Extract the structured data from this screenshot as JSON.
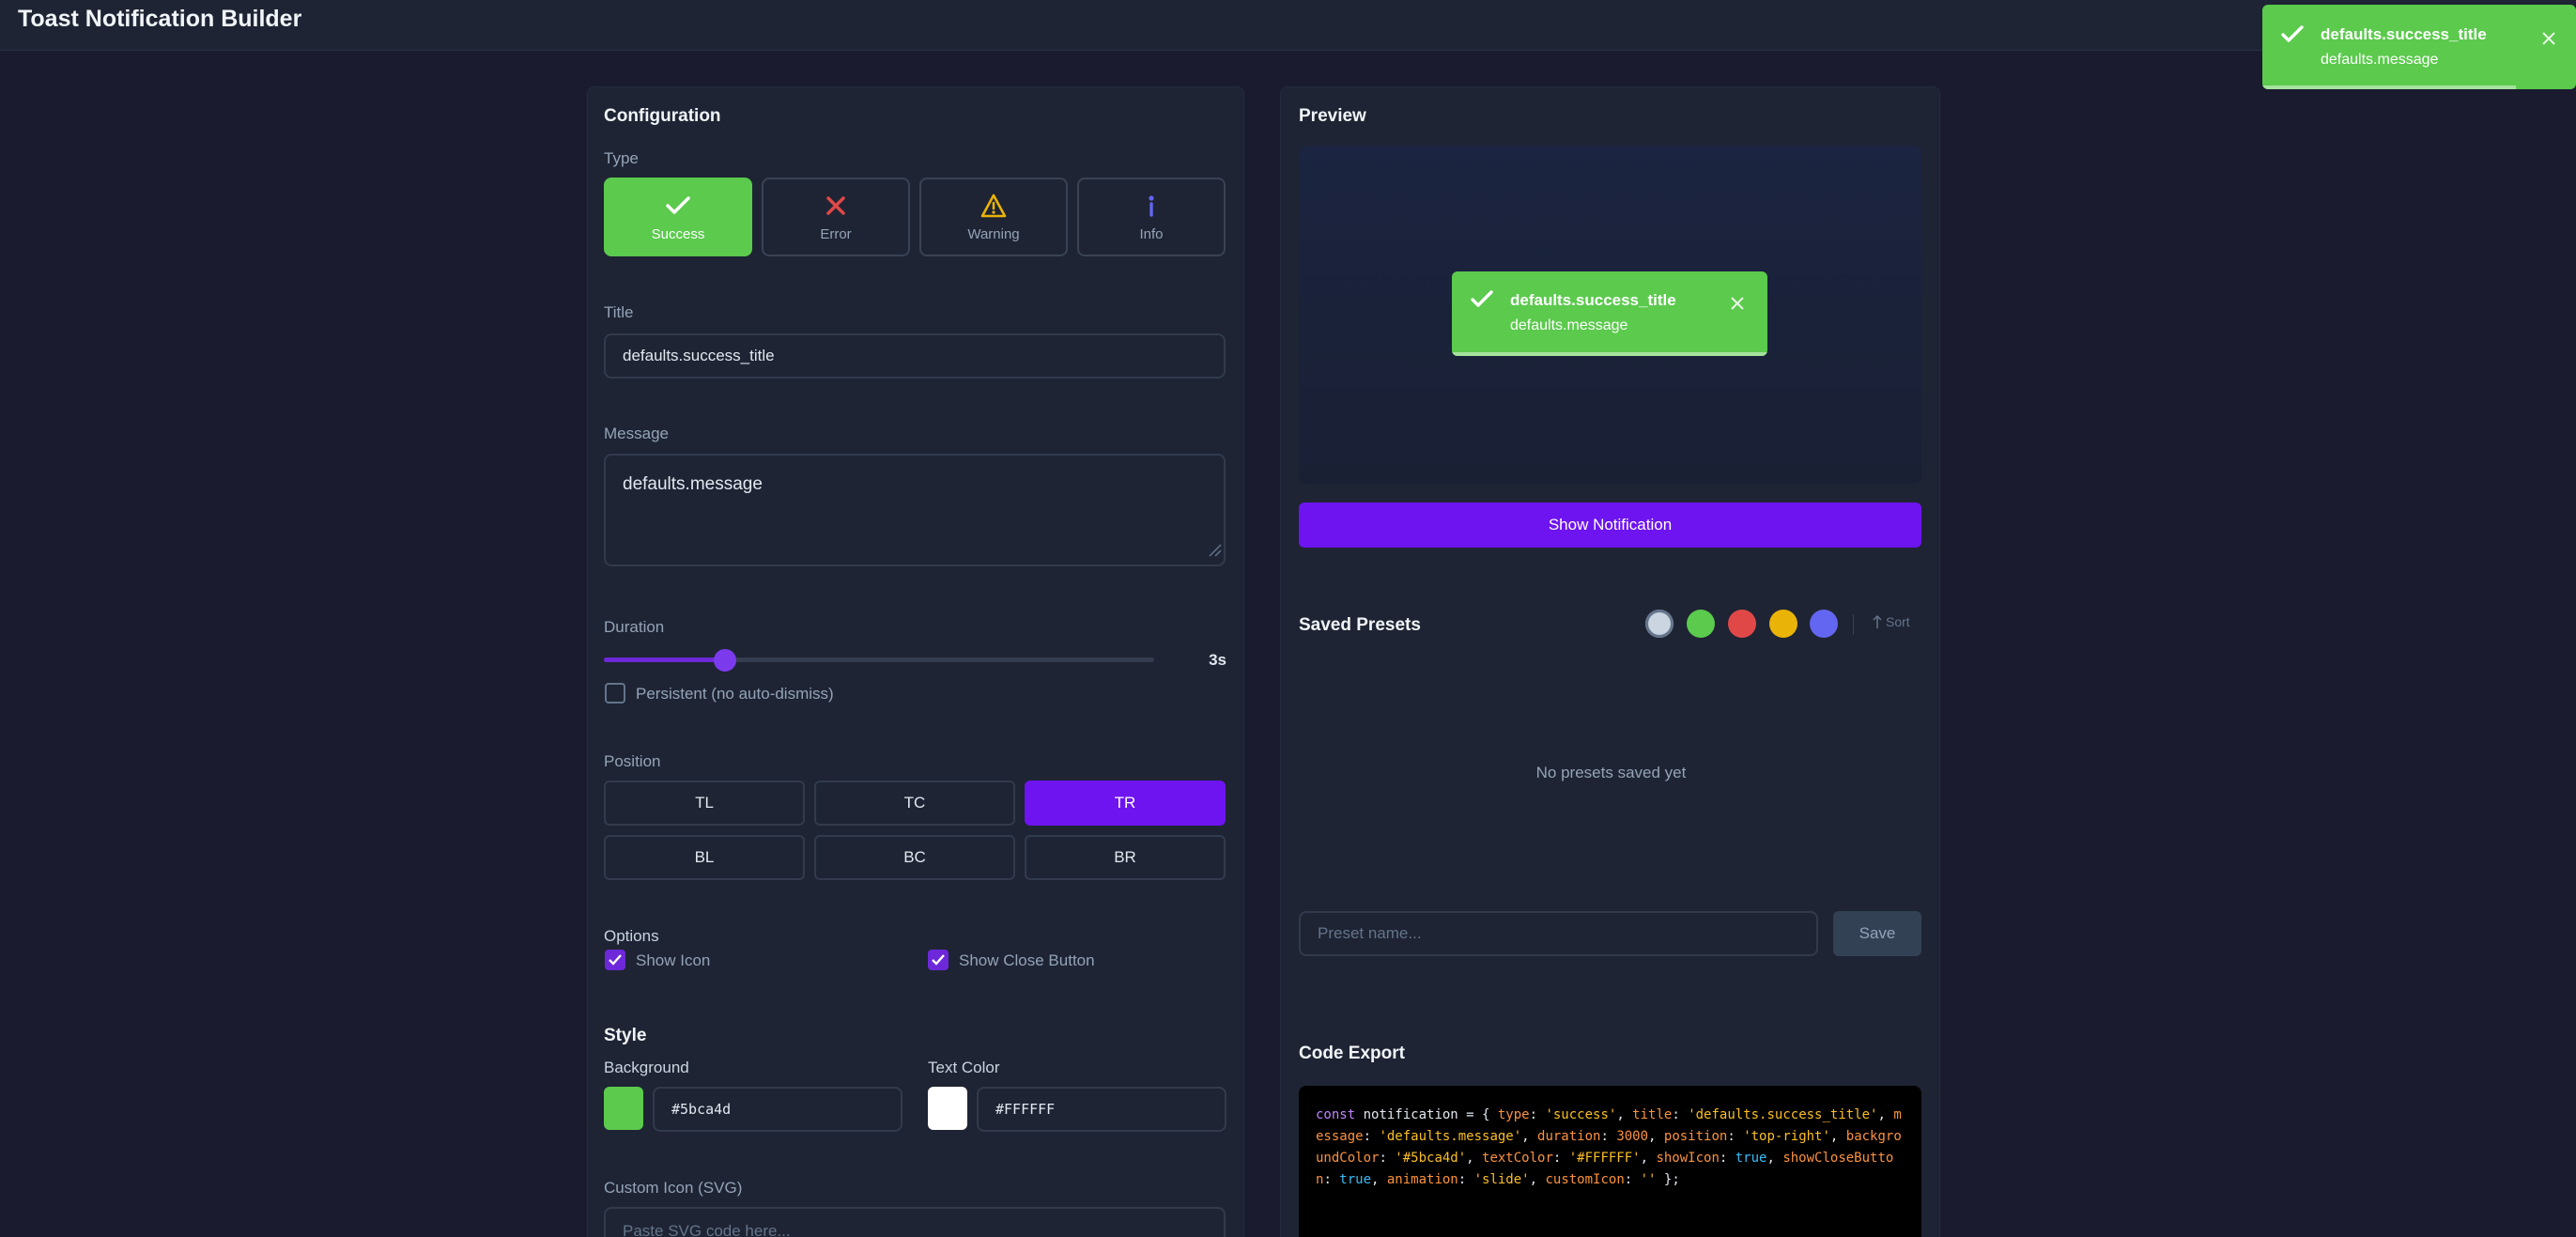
{
  "app": {
    "title": "Toast Notification Builder"
  },
  "config": {
    "heading": "Configuration",
    "type_label": "Type",
    "types": [
      {
        "label": "Success",
        "icon": "check-icon",
        "active": true
      },
      {
        "label": "Error",
        "icon": "x-icon",
        "active": false
      },
      {
        "label": "Warning",
        "icon": "warning-triangle-icon",
        "active": false
      },
      {
        "label": "Info",
        "icon": "info-icon",
        "active": false
      }
    ],
    "title_label": "Title",
    "title_value": "defaults.success_title",
    "message_label": "Message",
    "message_value": "defaults.message",
    "duration_label": "Duration",
    "duration_value": "3s",
    "duration_fraction": 0.22,
    "persistent_label": "Persistent (no auto-dismiss)",
    "position_label": "Position",
    "positions": [
      {
        "label": "TL",
        "active": false
      },
      {
        "label": "TC",
        "active": false
      },
      {
        "label": "TR",
        "active": true
      },
      {
        "label": "BL",
        "active": false
      },
      {
        "label": "BC",
        "active": false
      },
      {
        "label": "BR",
        "active": false
      }
    ],
    "options_label": "Options",
    "show_icon_label": "Show Icon",
    "show_close_label": "Show Close Button",
    "style_heading": "Style",
    "background_label": "Background",
    "background_value": "#5bca4d",
    "text_color_label": "Text Color",
    "text_color_value": "#FFFFFF",
    "custom_icon_label": "Custom Icon (SVG)",
    "custom_icon_placeholder": "Paste SVG code here..."
  },
  "preview": {
    "heading": "Preview",
    "toast_title": "defaults.success_title",
    "toast_message": "defaults.message",
    "show_button": "Show Notification"
  },
  "presets": {
    "heading": "Saved Presets",
    "sort_label": "Sort",
    "filter_colors": [
      "#e2e8f0",
      "#5bca4d",
      "#e04848",
      "#eab308",
      "#6366f1"
    ],
    "empty_text": "No presets saved yet",
    "name_placeholder": "Preset name...",
    "save_button": "Save"
  },
  "code": {
    "heading": "Code Export"
  },
  "live_toast": {
    "title": "defaults.success_title",
    "message": "defaults.message"
  },
  "colors": {
    "accent": "#6d14f0",
    "success": "#5bca4d",
    "error": "#e04848",
    "warning": "#eab308",
    "info": "#6366f1"
  }
}
